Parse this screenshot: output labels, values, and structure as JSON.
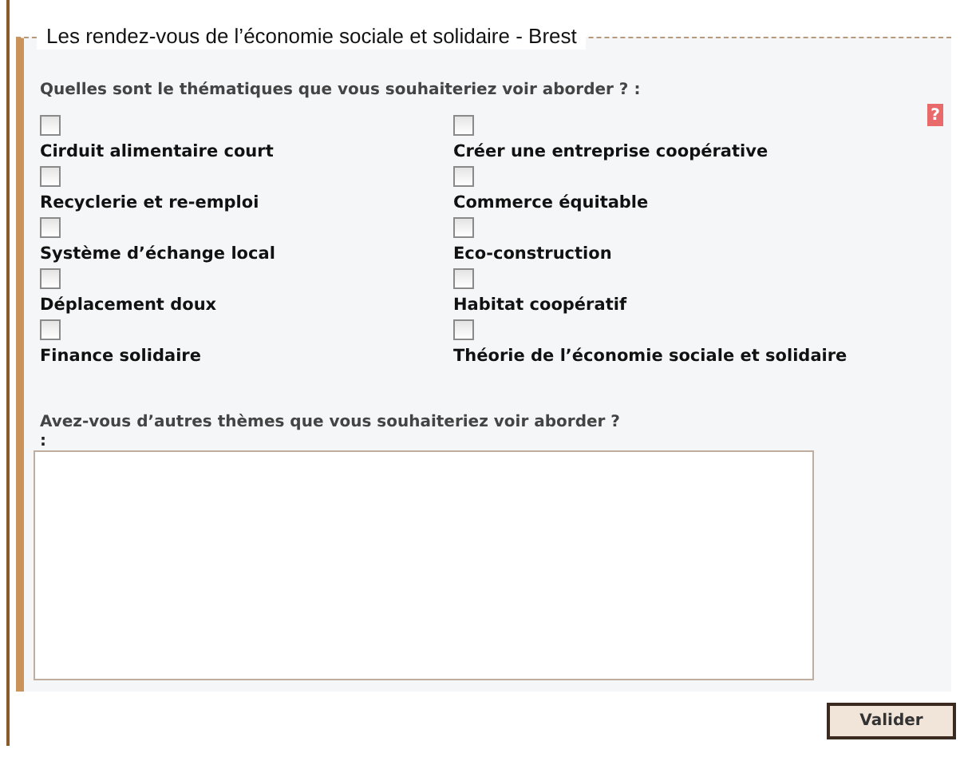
{
  "form": {
    "legend": "Les rendez-vous de l’économie sociale et solidaire - Brest",
    "help": "?",
    "question": "Quelles sont le thématiques que vous souhaiteriez voir aborder ? :",
    "themes": [
      {
        "label": "Cirduit alimentaire court",
        "checked": false
      },
      {
        "label": "Créer une entreprise coopérative",
        "checked": false
      },
      {
        "label": "Recyclerie et re-emploi",
        "checked": false
      },
      {
        "label": "Commerce équitable",
        "checked": false
      },
      {
        "label": "Système d’échange local",
        "checked": false
      },
      {
        "label": "Eco-construction",
        "checked": false
      },
      {
        "label": "Déplacement doux",
        "checked": false
      },
      {
        "label": "Habitat coopératif",
        "checked": false
      },
      {
        "label": "Finance solidaire",
        "checked": false
      },
      {
        "label": "Théorie de l’économie sociale et solidaire",
        "checked": false
      }
    ],
    "other_question": "Avez-vous d’autres thèmes que vous souhaiteriez voir aborder ?",
    "other_colon": ":"
  },
  "submit": "Valider"
}
